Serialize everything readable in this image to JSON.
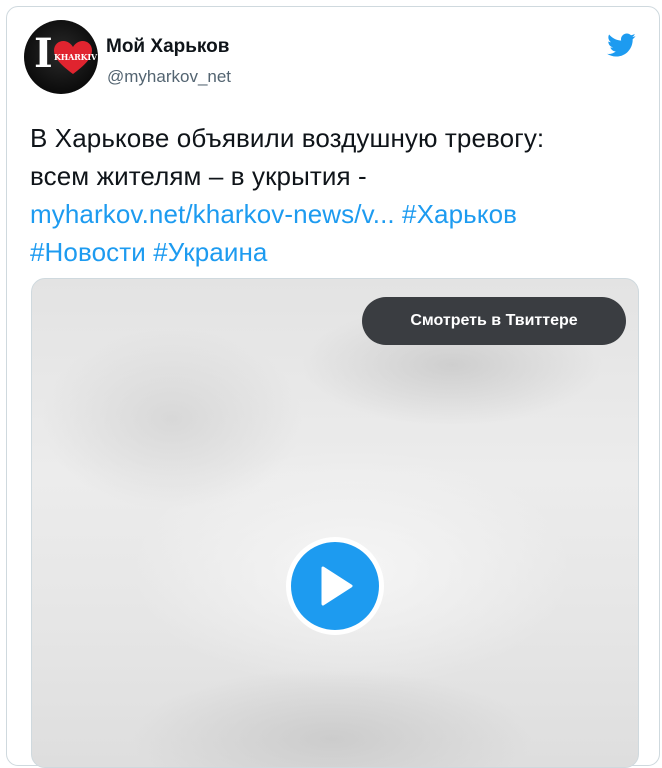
{
  "tweet": {
    "author_name": "Мой Харьков",
    "author_handle": "@myharkov_net",
    "avatar": {
      "letter": "I",
      "badge_text": "KHARKIV",
      "icon": "heart-icon"
    },
    "brand_icon": "twitter-bird-icon",
    "text_line1": "В Харькове объявили воздушную тревогу:",
    "text_line2": "всем жителям – в укрытия - ",
    "link": "myharkov.net/kharkov-news/v...",
    "hashtag1": "#Харьков",
    "hashtag2": "#Новости",
    "hashtag3": "#Украина"
  },
  "media": {
    "watch_button_label": "Смотреть в Твиттере",
    "play_icon": "play-icon"
  },
  "colors": {
    "link": "#1d9bf0",
    "text": "#0f1419",
    "secondary_text": "#536471",
    "border": "#cfd9de",
    "watch_button_bg": "#3a3d41",
    "avatar_heart": "#e0242f"
  }
}
